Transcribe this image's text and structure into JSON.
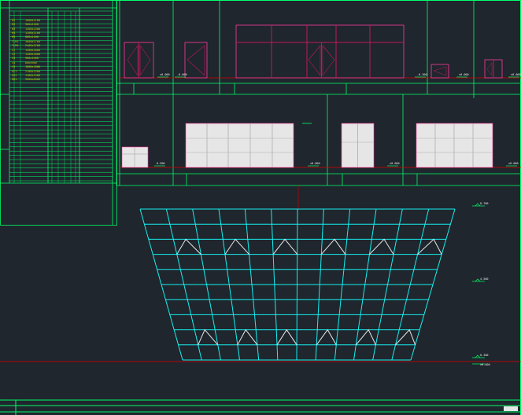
{
  "drawing": {
    "colors": {
      "background": "#1f262d",
      "frame": "#00ff6a",
      "door_outline": "#ff3aa0",
      "door_frame": "#c2185b",
      "cabinet_fill": "#e6e6e6",
      "curtain_wall": "#16f0f0",
      "ground_line": "#e00000",
      "elevation_tick": "#00ff6a",
      "legend_text": "#c8c800"
    },
    "schedule_rows": [
      {
        "code": "M1",
        "spec": "1000x2100"
      },
      {
        "code": "M2",
        "spec": "900x2100"
      },
      {
        "code": "M3",
        "spec": "1500x2400"
      },
      {
        "code": "M4",
        "spec": "1200x2100"
      },
      {
        "code": "M5",
        "spec": "800x2100"
      },
      {
        "code": "TLM1",
        "spec": "3600x2700"
      },
      {
        "code": "TLM2",
        "spec": "2400x2700"
      },
      {
        "code": "C1",
        "spec": "1500x1800"
      },
      {
        "code": "C2",
        "spec": "1200x1800"
      },
      {
        "code": "C3",
        "spec": "900x1500"
      },
      {
        "code": "C4",
        "spec": "600x900"
      },
      {
        "code": "C5",
        "spec": "1800x1800"
      },
      {
        "code": "GC1",
        "spec": "2100x1500"
      },
      {
        "code": "GC2",
        "spec": "1500x1500"
      },
      {
        "code": "MQ1",
        "spec": "9000x6000"
      }
    ],
    "top_row_tags": [
      "±0.000",
      "-0.600",
      "-0.300",
      "±0.000",
      "±0.000"
    ],
    "middle_row_tags": [
      "0.900",
      "±0.000",
      "±0.000",
      "±0.000"
    ],
    "curtain_tags": [
      "8.700",
      "4.500",
      "0.300",
      "±0.000"
    ],
    "curtain_grid": {
      "columns": 12,
      "rows": 10,
      "triangle_rows": [
        3,
        9
      ]
    }
  }
}
